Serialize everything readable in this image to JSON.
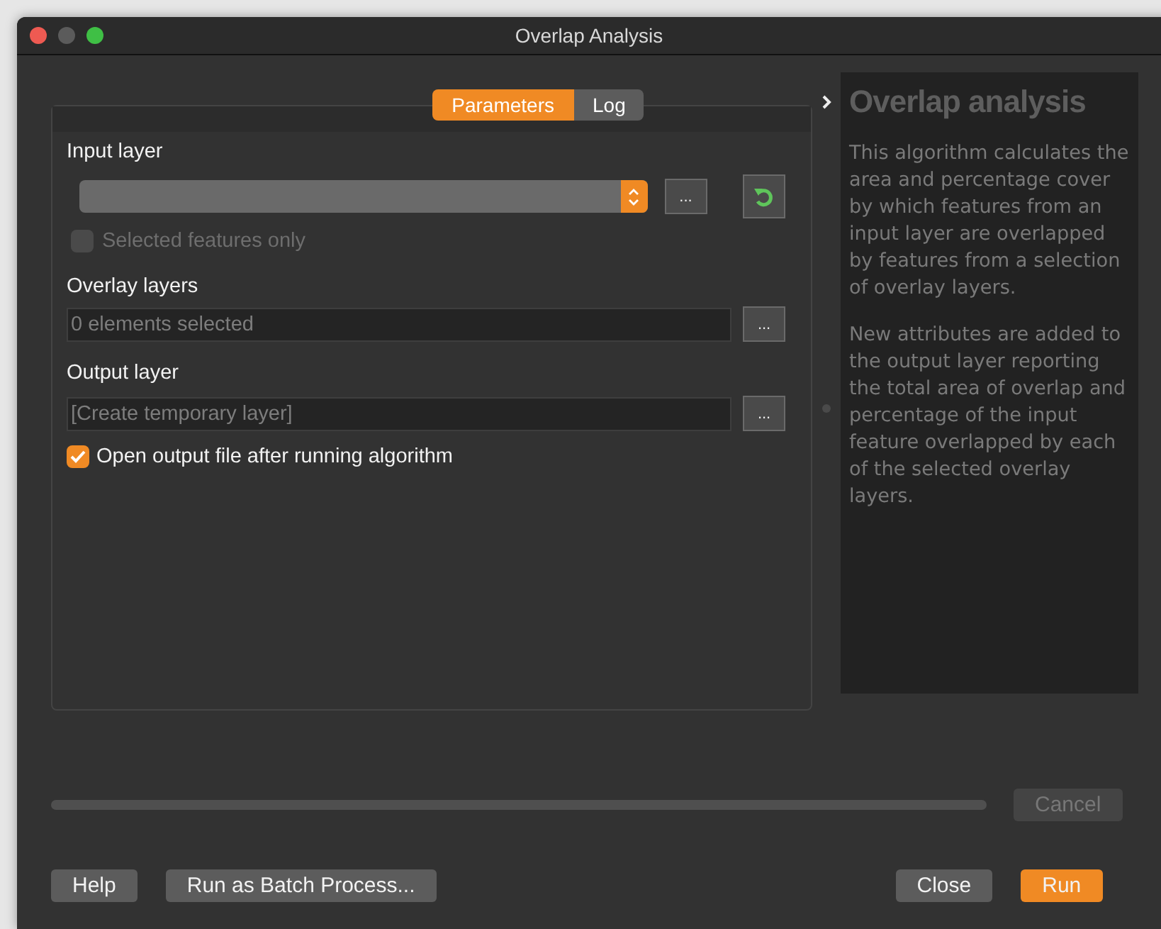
{
  "window": {
    "title": "Overlap Analysis"
  },
  "tabs": [
    {
      "label": "Parameters",
      "selected": true
    },
    {
      "label": "Log",
      "selected": false
    }
  ],
  "parameters": {
    "input_layer": {
      "label": "Input layer",
      "browse_button": "...",
      "selected_only": {
        "label": "Selected features only",
        "checked": false,
        "disabled": true
      }
    },
    "overlay_layers": {
      "label": "Overlay layers",
      "placeholder": "0 elements selected",
      "browse_button": "..."
    },
    "output_layer": {
      "label": "Output layer",
      "placeholder": "[Create temporary layer]",
      "browse_button": "..."
    },
    "open_output": {
      "label": "Open output file after running algorithm",
      "checked": true
    }
  },
  "help": {
    "title": "Overlap analysis",
    "paragraphs": [
      "This algorithm calculates the area and percentage cover by which features from an input layer are overlapped by features from a selection of overlay layers.",
      "New attributes are added to the output layer reporting the total area of overlap and percentage of the input feature overlapped by each of the selected overlay layers."
    ]
  },
  "cancel": {
    "label": "Cancel",
    "disabled": true
  },
  "buttons": [
    {
      "label": "Help",
      "kind": "normal"
    },
    {
      "label": "Run as Batch Process...",
      "kind": "normal"
    },
    {
      "label": "Close",
      "kind": "normal"
    },
    {
      "label": "Run",
      "kind": "primary"
    }
  ]
}
